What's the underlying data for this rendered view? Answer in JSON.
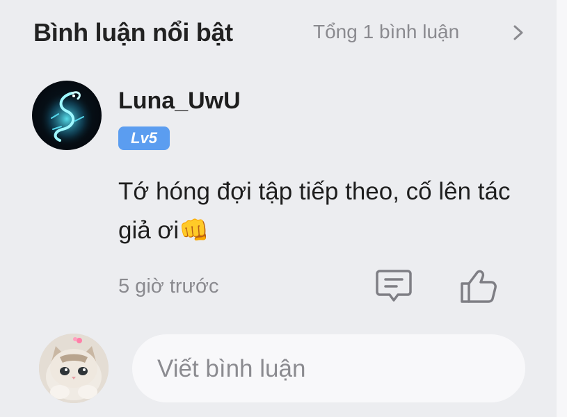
{
  "header": {
    "title": "Bình luận nổi bật",
    "count_label": "Tổng 1 bình luận"
  },
  "comment": {
    "username": "Luna_UwU",
    "level": "Lv5",
    "text": "Tớ hóng đợi tập tiếp theo, cố lên tác giả ơi👊",
    "time": "5 giờ trước"
  },
  "composer": {
    "placeholder": "Viết bình luận"
  },
  "colors": {
    "accent": "#5b9df0",
    "muted_text": "#8a8a8f",
    "panel_bg": "#ecedf0",
    "input_bg": "#f8f8fa"
  },
  "icons": {
    "header_chevron": "chevron-right-icon",
    "reply": "comment-reply-icon",
    "like": "thumbs-up-icon"
  }
}
